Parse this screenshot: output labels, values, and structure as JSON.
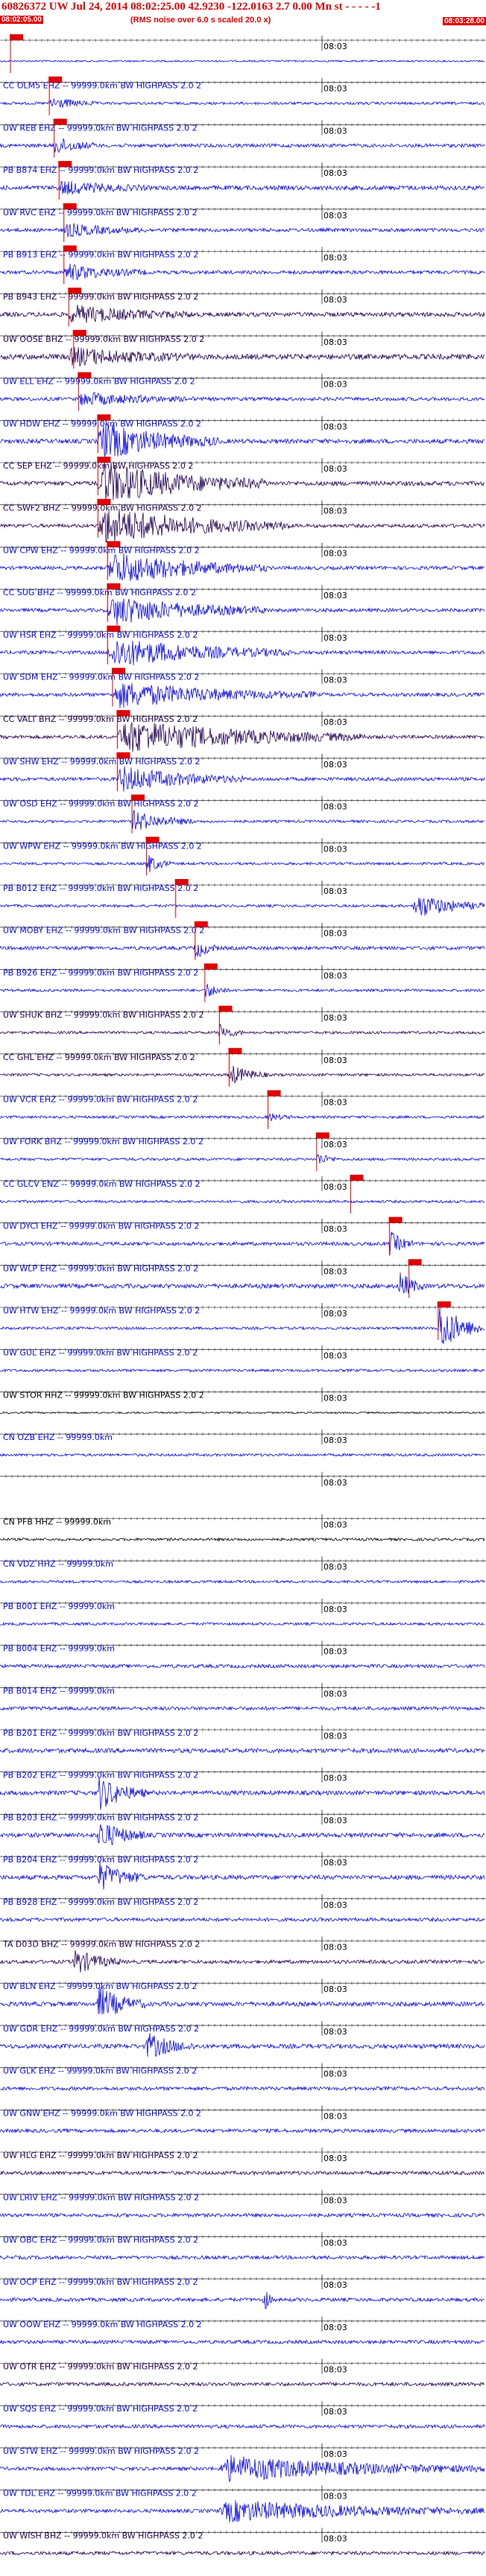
{
  "header": {
    "title": "60826372 UW Jul 24, 2014 08:02:25.00    42.9230  -122.0163   2.7  0.00  Mn st - - - - -1",
    "subtitle": "(RMS noise over 6.0 s scaled 20.0 x)",
    "start_time": "08:02:05.00",
    "end_time": "08:03:28.00"
  },
  "time_tick_label": "08:03",
  "colors": {
    "blue": "#0a0adf",
    "navy": "#200050",
    "black": "#000000",
    "red": "#e00000",
    "pick": "#e00000"
  },
  "traces": [
    {
      "label": "",
      "color": "blue",
      "amp": 2,
      "burst": null,
      "pick": 0.02
    },
    {
      "label": "CC OLM5 EHZ -- 99999.0km BW  HIGHPASS  2.0  2",
      "color": "blue",
      "amp": 3,
      "burst": [
        0.1,
        0.2,
        3
      ],
      "pick": 0.1
    },
    {
      "label": "UW REB EHZ -- 99999.0km BW  HIGHPASS  2.0  2",
      "color": "blue",
      "amp": 4,
      "burst": [
        0.11,
        0.2,
        4
      ],
      "pick": 0.11
    },
    {
      "label": "PB B874 EHZ -- 99999.0km BW  HIGHPASS  2.0  2",
      "color": "blue",
      "amp": 5,
      "burst": [
        0.12,
        0.3,
        3
      ],
      "pick": 0.12
    },
    {
      "label": "UW RVC EHZ -- 99999.0km BW  HIGHPASS  2.0  2",
      "color": "blue",
      "amp": 4,
      "burst": [
        0.13,
        0.3,
        3
      ],
      "pick": 0.13
    },
    {
      "label": "PB B913 EHZ -- 99999.0km BW  HIGHPASS  2.0  2",
      "color": "blue",
      "amp": 4,
      "burst": [
        0.13,
        0.3,
        4
      ],
      "pick": 0.13
    },
    {
      "label": "PB B943 EHZ -- 99999.0km BW  HIGHPASS  2.0  2",
      "color": "navy",
      "amp": 5,
      "burst": [
        0.14,
        0.4,
        4
      ],
      "pick": 0.14
    },
    {
      "label": "UW OOSE BHZ -- 99999.0km BW  HIGHPASS  2.0  2",
      "color": "navy",
      "amp": 6,
      "burst": [
        0.14,
        0.4,
        4
      ],
      "pick": 0.15
    },
    {
      "label": "UW ELL EHZ -- 99999.0km BW  HIGHPASS  2.0  2",
      "color": "blue",
      "amp": 4,
      "burst": [
        0.16,
        0.4,
        3
      ],
      "pick": 0.16
    },
    {
      "label": "UW HDW EHZ -- 99999.0km BW  HIGHPASS  2.0  2",
      "color": "blue",
      "amp": 5,
      "burst": [
        0.2,
        0.45,
        9
      ],
      "pick": 0.2
    },
    {
      "label": "CC SEP EHZ -- 99999.0km BW  HIGHPASS  2.0  2",
      "color": "navy",
      "amp": 5,
      "burst": [
        0.2,
        0.55,
        10
      ],
      "pick": 0.2
    },
    {
      "label": "CC SWF2 BHZ -- 99999.0km BW  HIGHPASS  2.0  2",
      "color": "navy",
      "amp": 4,
      "burst": [
        0.2,
        0.6,
        9
      ],
      "pick": 0.2
    },
    {
      "label": "UW CPW EHZ -- 99999.0km BW  HIGHPASS  2.0  2",
      "color": "blue",
      "amp": 4,
      "burst": [
        0.22,
        0.55,
        8
      ],
      "pick": 0.22
    },
    {
      "label": "CC SUG BHZ -- 99999.0km BW  HIGHPASS  2.0  2",
      "color": "blue",
      "amp": 4,
      "burst": [
        0.22,
        0.55,
        7
      ],
      "pick": 0.22
    },
    {
      "label": "UW HSR EHZ -- 99999.0km BW  HIGHPASS  2.0  2",
      "color": "blue",
      "amp": 4,
      "burst": [
        0.22,
        0.6,
        7
      ],
      "pick": 0.22
    },
    {
      "label": "UW SDM EHZ -- 99999.0km BW  HIGHPASS  2.0  2",
      "color": "blue",
      "amp": 4,
      "burst": [
        0.23,
        0.65,
        6
      ],
      "pick": 0.23
    },
    {
      "label": "CC VALT BHZ -- 99999.0km BW  HIGHPASS  2.0  2",
      "color": "navy",
      "amp": 4,
      "burst": [
        0.24,
        0.75,
        8
      ],
      "pick": 0.24
    },
    {
      "label": "UW SHW EHZ -- 99999.0km BW  HIGHPASS  2.0  2",
      "color": "blue",
      "amp": 4,
      "burst": [
        0.24,
        0.5,
        6
      ],
      "pick": 0.24
    },
    {
      "label": "UW OSD EHZ -- 99999.0km BW  HIGHPASS  2.0  2",
      "color": "blue",
      "amp": 3,
      "burst": [
        0.27,
        0.4,
        5
      ],
      "pick": 0.27
    },
    {
      "label": "UW WPW EHZ -- 99999.0km BW  HIGHPASS  2.0  2",
      "color": "blue",
      "amp": 3,
      "burst": [
        0.3,
        0.35,
        5
      ],
      "pick": 0.3
    },
    {
      "label": "PB B012 EHZ -- 99999.0km BW  HIGHPASS  2.0  2",
      "color": "blue",
      "amp": 3,
      "burst": [
        0.85,
        1.0,
        6
      ],
      "pick": 0.36
    },
    {
      "label": "UW MOBY EHZ -- 99999.0km BW  HIGHPASS  2.0  2",
      "color": "blue",
      "amp": 4,
      "burst": [
        0.4,
        0.45,
        5
      ],
      "pick": 0.4
    },
    {
      "label": "PB B926 EHZ -- 99999.0km BW  HIGHPASS  2.0  2",
      "color": "blue",
      "amp": 3,
      "burst": [
        0.42,
        0.47,
        4
      ],
      "pick": 0.42
    },
    {
      "label": "UW SHUK BHZ -- 99999.0km BW  HIGHPASS  2.0  2",
      "color": "navy",
      "amp": 3,
      "burst": [
        0.45,
        0.5,
        4
      ],
      "pick": 0.45
    },
    {
      "label": "CC GHL EHZ -- 99999.0km BW  HIGHPASS  2.0  2",
      "color": "navy",
      "amp": 3,
      "burst": [
        0.47,
        0.55,
        5
      ],
      "pick": 0.47
    },
    {
      "label": "UW VCR EHZ -- 99999.0km BW  HIGHPASS  2.0  2",
      "color": "blue",
      "amp": 3,
      "burst": [
        0.55,
        0.6,
        2
      ],
      "pick": 0.55
    },
    {
      "label": "UW FORK BHZ -- 99999.0km BW  HIGHPASS  2.0  2",
      "color": "blue",
      "amp": 3,
      "burst": [
        0.65,
        0.7,
        3
      ],
      "pick": 0.65
    },
    {
      "label": "CC GLCV ENZ -- 99999.0km BW  HIGHPASS  2.0  2",
      "color": "blue",
      "amp": 3,
      "burst": null,
      "pick": 0.72
    },
    {
      "label": "UW DYCI EHZ -- 99999.0km BW  HIGHPASS  2.0  2",
      "color": "blue",
      "amp": 4,
      "burst": [
        0.8,
        0.85,
        6
      ],
      "pick": 0.8
    },
    {
      "label": "UW WLP EHZ -- 99999.0km BW  HIGHPASS  2.0  2",
      "color": "blue",
      "amp": 5,
      "burst": [
        0.82,
        0.87,
        7
      ],
      "pick": 0.84
    },
    {
      "label": "UW HTW EHZ -- 99999.0km BW  HIGHPASS  2.0  2",
      "color": "blue",
      "amp": 3,
      "burst": [
        0.9,
        1.0,
        12
      ],
      "pick": 0.9
    },
    {
      "label": "UW GUL EHZ -- 99999.0km BW  HIGHPASS  2.0  2",
      "color": "blue",
      "amp": 3,
      "burst": null,
      "pick": null
    },
    {
      "label": "UW STOR HHZ -- 99999.0km BW  HIGHPASS  2.0  2",
      "color": "black",
      "amp": 2,
      "burst": null,
      "pick": null
    },
    {
      "label": "CN OZB EHZ -- 99999.0km",
      "color": "blue",
      "amp": 3,
      "burst": null,
      "pick": null
    },
    {
      "label": "",
      "color": "black",
      "amp": 0,
      "burst": null,
      "pick": null
    },
    {
      "label": "CN PFB HHZ -- 99999.0km",
      "color": "black",
      "amp": 3,
      "burst": null,
      "pick": null
    },
    {
      "label": "CN VDZ HHZ -- 99999.0km",
      "color": "blue",
      "amp": 3,
      "burst": null,
      "pick": null
    },
    {
      "label": "PB B001 EHZ -- 99999.0km",
      "color": "blue",
      "amp": 3,
      "burst": null,
      "pick": null
    },
    {
      "label": "PB B004 EHZ -- 99999.0km",
      "color": "blue",
      "amp": 4,
      "burst": null,
      "pick": null
    },
    {
      "label": "PB B014 EHZ -- 99999.0km",
      "color": "blue",
      "amp": 4,
      "burst": null,
      "pick": null
    },
    {
      "label": "PB B201 EHZ -- 99999.0km BW  HIGHPASS  2.0  2",
      "color": "blue",
      "amp": 5,
      "burst": null,
      "pick": null
    },
    {
      "label": "PB B202 EHZ -- 99999.0km BW  HIGHPASS  2.0  2",
      "color": "blue",
      "amp": 5,
      "burst": [
        0.2,
        0.3,
        8
      ],
      "pick": null
    },
    {
      "label": "PB B203 EHZ -- 99999.0km BW  HIGHPASS  2.0  2",
      "color": "blue",
      "amp": 5,
      "burst": [
        0.2,
        0.3,
        7
      ],
      "pick": null
    },
    {
      "label": "PB B204 EHZ -- 99999.0km BW  HIGHPASS  2.0  2",
      "color": "blue",
      "amp": 5,
      "burst": [
        0.2,
        0.3,
        7
      ],
      "pick": null
    },
    {
      "label": "PB B928 EHZ -- 99999.0km BW  HIGHPASS  2.0  2",
      "color": "blue",
      "amp": 4,
      "burst": null,
      "pick": null
    },
    {
      "label": "TA D03D BHZ -- 99999.0km BW  HIGHPASS  2.0  2",
      "color": "navy",
      "amp": 4,
      "burst": [
        0.15,
        0.25,
        6
      ],
      "pick": null
    },
    {
      "label": "UW BLN EHZ -- 99999.0km BW  HIGHPASS  2.0  2",
      "color": "blue",
      "amp": 5,
      "burst": [
        0.2,
        0.3,
        8
      ],
      "pick": null
    },
    {
      "label": "UW GDR EHZ -- 99999.0km BW  HIGHPASS  2.0  2",
      "color": "blue",
      "amp": 5,
      "burst": [
        0.3,
        0.4,
        6
      ],
      "pick": null
    },
    {
      "label": "UW GLK EHZ -- 99999.0km BW  HIGHPASS  2.0  2",
      "color": "blue",
      "amp": 4,
      "burst": null,
      "pick": null
    },
    {
      "label": "UW GNW EHZ -- 99999.0km BW  HIGHPASS  2.0  2",
      "color": "blue",
      "amp": 4,
      "burst": null,
      "pick": null
    },
    {
      "label": "UW HLG EHZ -- 99999.0km BW  HIGHPASS  2.0  2",
      "color": "navy",
      "amp": 4,
      "burst": null,
      "pick": null
    },
    {
      "label": "UW LRIV EHZ -- 99999.0km BW  HIGHPASS  2.0  2",
      "color": "blue",
      "amp": 4,
      "burst": null,
      "pick": null
    },
    {
      "label": "UW OBC EHZ -- 99999.0km BW  HIGHPASS  2.0  2",
      "color": "blue",
      "amp": 4,
      "burst": null,
      "pick": null
    },
    {
      "label": "UW OCP EHZ -- 99999.0km BW  HIGHPASS  2.0  2",
      "color": "blue",
      "amp": 4,
      "burst": [
        0.54,
        0.56,
        8
      ],
      "pick": null
    },
    {
      "label": "UW OOW EHZ -- 99999.0km BW  HIGHPASS  2.0  2",
      "color": "blue",
      "amp": 4,
      "burst": null,
      "pick": null
    },
    {
      "label": "UW OTR EHZ -- 99999.0km BW  HIGHPASS  2.0  2",
      "color": "navy",
      "amp": 4,
      "burst": null,
      "pick": null
    },
    {
      "label": "UW SQS EHZ -- 99999.0km BW  HIGHPASS  2.0  2",
      "color": "blue",
      "amp": 4,
      "burst": null,
      "pick": null
    },
    {
      "label": "UW STW EHZ -- 99999.0km BW  HIGHPASS  2.0  2",
      "color": "blue",
      "amp": 4,
      "burst": [
        0.45,
        1.0,
        6
      ],
      "pick": null
    },
    {
      "label": "UW TDL EHZ -- 99999.0km BW  HIGHPASS  2.0  2",
      "color": "blue",
      "amp": 4,
      "burst": [
        0.45,
        1.0,
        5
      ],
      "pick": null
    },
    {
      "label": "UW WISH BHZ -- 99999.0km BW  HIGHPASS  2.0  2",
      "color": "navy",
      "amp": 4,
      "burst": null,
      "pick": null
    }
  ]
}
